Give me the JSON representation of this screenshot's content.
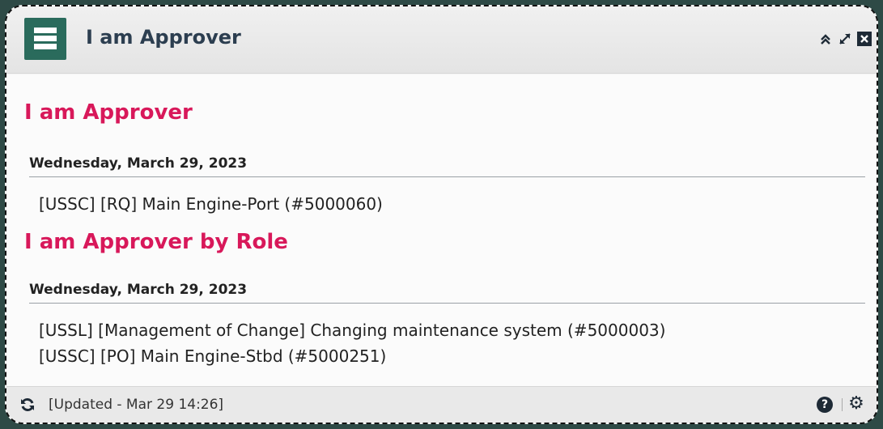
{
  "widget": {
    "title": "I am Approver",
    "controls": {
      "collapse_icon": "double-chevron-up-icon",
      "expand_icon": "expand-icon",
      "close_icon": "close-icon"
    }
  },
  "sections": [
    {
      "title": "I am Approver",
      "date": "Wednesday, March 29, 2023",
      "items": [
        "[USSC] [RQ] Main Engine-Port (#5000060)"
      ]
    },
    {
      "title": "I am Approver by Role",
      "date": "Wednesday, March 29, 2023",
      "items": [
        "[USSL] [Management of Change] Changing maintenance system (#5000003)",
        "[USSC] [PO] Main Engine-Stbd (#5000251)"
      ]
    }
  ],
  "footer": {
    "updated_text": "[Updated - Mar 29 14:26]"
  },
  "colors": {
    "accent": "#d8185a",
    "brand": "#2a6b5c",
    "title": "#2c3e50"
  }
}
